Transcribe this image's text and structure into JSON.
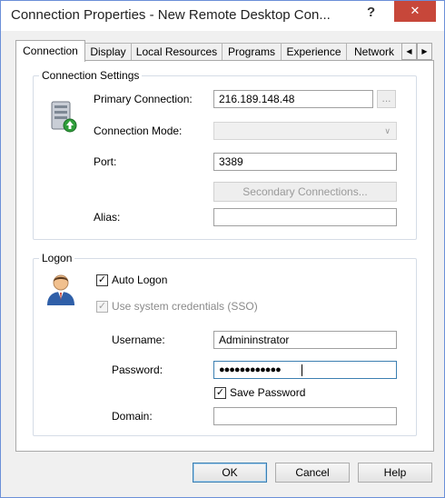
{
  "window": {
    "title": "Connection Properties - New Remote Desktop Con...",
    "help": "?",
    "close": "✕"
  },
  "tabs": [
    "Connection",
    "Display",
    "Local Resources",
    "Programs",
    "Experience",
    "Network"
  ],
  "tab_scroll": {
    "left": "◀",
    "right": "▶"
  },
  "connection_settings": {
    "title": "Connection Settings",
    "primary_label": "Primary Connection:",
    "primary_value": "216.189.148.48",
    "browse": "...",
    "mode_label": "Connection Mode:",
    "mode_value": "",
    "mode_arrow": "∨",
    "port_label": "Port:",
    "port_value": "3389",
    "secondary_button": "Secondary Connections...",
    "alias_label": "Alias:",
    "alias_value": ""
  },
  "logon": {
    "title": "Logon",
    "auto_logon": "Auto Logon",
    "auto_logon_checked": true,
    "sso": "Use system credentials (SSO)",
    "sso_checked": true,
    "username_label": "Username:",
    "username_value": "Admininstrator",
    "password_label": "Password:",
    "password_value": "●●●●●●●●●●●●",
    "save_password": "Save Password",
    "save_password_checked": true,
    "domain_label": "Domain:",
    "domain_value": "",
    "check_mark": "✓"
  },
  "buttons": {
    "ok": "OK",
    "cancel": "Cancel",
    "help": "Help"
  }
}
